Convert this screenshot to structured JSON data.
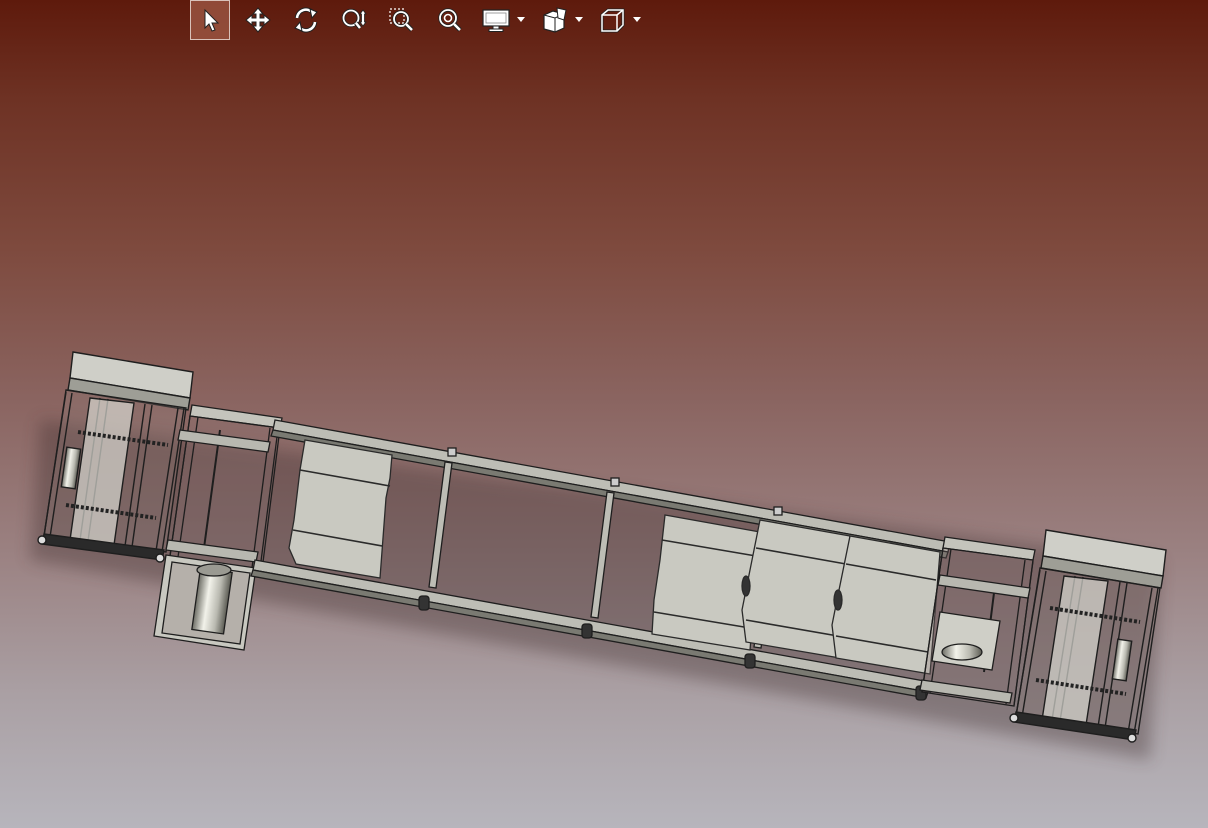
{
  "toolbar": {
    "items": [
      {
        "name": "select-tool",
        "icon": "arrow-cursor-icon",
        "active": true
      },
      {
        "name": "pan-tool",
        "icon": "move-arrows-icon",
        "active": false
      },
      {
        "name": "rotate-tool",
        "icon": "rotate-icon",
        "active": false
      },
      {
        "name": "zoom-in-out-tool",
        "icon": "zoom-in-out-icon",
        "active": false
      },
      {
        "name": "zoom-to-area-tool",
        "icon": "zoom-area-icon",
        "active": false
      },
      {
        "name": "zoom-to-fit-tool",
        "icon": "zoom-fit-icon",
        "active": false
      },
      {
        "name": "display-style-menu",
        "icon": "monitor-icon",
        "has_dropdown": true
      },
      {
        "name": "section-view-menu",
        "icon": "section-cube-icon",
        "has_dropdown": true
      },
      {
        "name": "view-orientation-menu",
        "icon": "cube-view-icon",
        "has_dropdown": true
      }
    ]
  },
  "viewport": {
    "background_top": "#5e1a0c",
    "background_bottom": "#b7b5bc",
    "model": "conveyor-assembly-3d-model"
  },
  "colors": {
    "part_fill": "#c8c8c0",
    "part_edge": "#2a2a2a",
    "frame_edge": "#1e1e1e"
  }
}
